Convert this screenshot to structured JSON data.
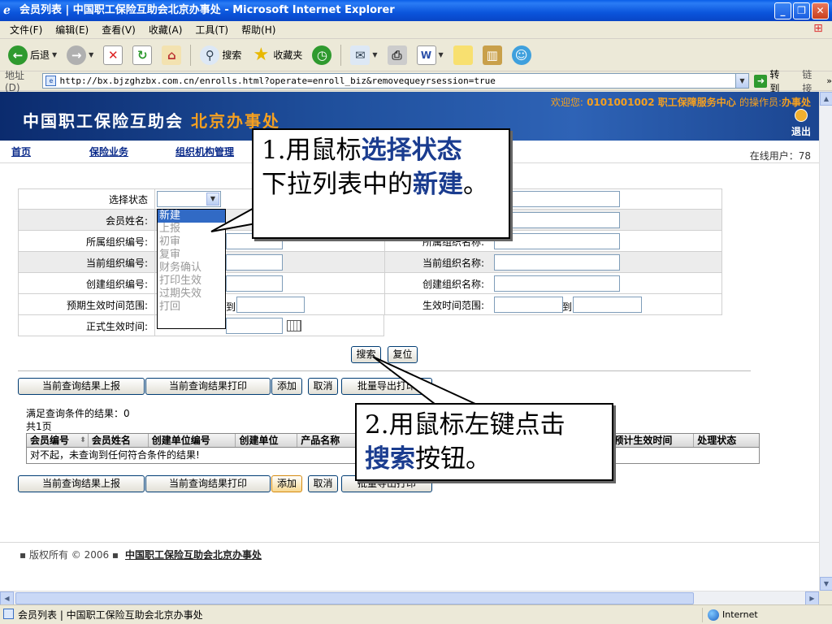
{
  "window": {
    "title": "会员列表 | 中国职工保险互助会北京办事处 - Microsoft Internet Explorer"
  },
  "menu": [
    "文件(F)",
    "编辑(E)",
    "查看(V)",
    "收藏(A)",
    "工具(T)",
    "帮助(H)"
  ],
  "toolbar": {
    "back": "后退",
    "search": "搜索",
    "favorites": "收藏夹"
  },
  "address": {
    "label": "地址(D)",
    "url": "http://bx.bjzghzbx.com.cn/enrolls.html?operate=enroll_biz&removequeyrsession=true",
    "go": "转到",
    "links": "链接"
  },
  "header": {
    "org_name_a": "中国职工保险互助会",
    "org_name_b": "北京办事处",
    "welcome_prefix": "欢迎您:",
    "welcome_id": "0101001002 职工保障服务中心",
    "welcome_role_prefix": "的操作员:",
    "welcome_role": "办事处",
    "exit": "退出"
  },
  "nav": {
    "items": [
      "首页",
      "保险业务",
      "组织机构管理"
    ],
    "online": "在线用户：78"
  },
  "form": {
    "status_label": "选择状态",
    "name_label": "会员姓名:",
    "org_code_label": "所属组织编号:",
    "org_name_label": "所属组织名称:",
    "cur_code_label": "当前组织编号:",
    "cur_name_label": "当前组织名称:",
    "create_code_label": "创建组织编号:",
    "create_name_label": "创建组织名称:",
    "expect_range_label": "预期生效时间范围:",
    "effect_range_label": "生效时间范围:",
    "formal_time_label": "正式生效时间:",
    "to": "到",
    "status_options": [
      "新建",
      "上报",
      "初审",
      "复审",
      "财务确认",
      "打印生效",
      "过期失效",
      "打回"
    ]
  },
  "buttons": {
    "search": "搜索",
    "reset": "复位",
    "report": "当前查询结果上报",
    "print": "当前查询结果打印",
    "add": "添加",
    "cancel": "取消",
    "batch_print": "批量导出打印"
  },
  "results": {
    "count": "满足查询条件的结果：0",
    "pages": "共1页",
    "columns": [
      "会员编号",
      "会员姓名",
      "创建单位编号",
      "创建单位",
      "产品名称",
      "预计生效时间",
      "处理状态"
    ],
    "empty": "对不起，未查询到任何符合条件的结果!"
  },
  "footer": {
    "copyright": "▪ 版权所有 © 2006 ▪",
    "org": "中国职工保险互助会北京办事处"
  },
  "callouts": {
    "one_prefix": "1.用鼠标",
    "one_hl1": "选择状态",
    "one_mid": "下拉列表中的",
    "one_hl2": "新建",
    "one_end": "。",
    "two_line1": "2.用鼠标左键点击",
    "two_hl": "搜索",
    "two_end": "按钮。"
  },
  "status": {
    "text": "会员列表 | 中国职工保险互助会北京办事处",
    "zone": "Internet"
  }
}
